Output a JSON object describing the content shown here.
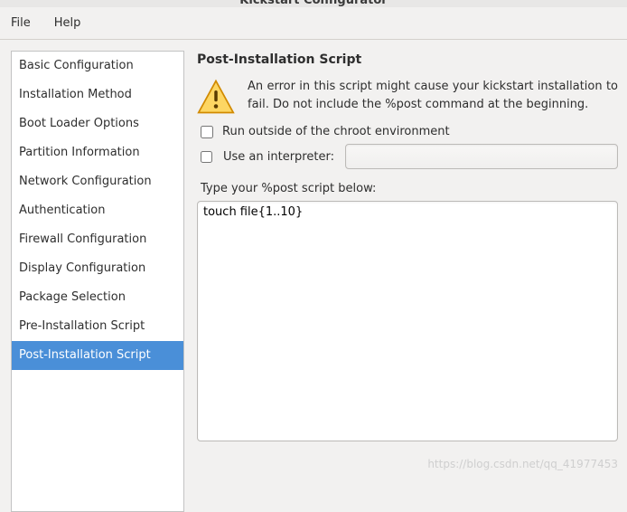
{
  "window": {
    "title": "Kickstart Configurator"
  },
  "menubar": {
    "file": "File",
    "help": "Help"
  },
  "sidebar": {
    "items": [
      {
        "label": "Basic Configuration",
        "selected": false
      },
      {
        "label": "Installation Method",
        "selected": false
      },
      {
        "label": "Boot Loader Options",
        "selected": false
      },
      {
        "label": "Partition Information",
        "selected": false
      },
      {
        "label": "Network Configuration",
        "selected": false
      },
      {
        "label": "Authentication",
        "selected": false
      },
      {
        "label": "Firewall Configuration",
        "selected": false
      },
      {
        "label": "Display Configuration",
        "selected": false
      },
      {
        "label": "Package Selection",
        "selected": false
      },
      {
        "label": "Pre-Installation Script",
        "selected": false
      },
      {
        "label": "Post-Installation Script",
        "selected": true
      }
    ]
  },
  "main": {
    "heading": "Post-Installation Script",
    "warning": "An error in this script might cause your kickstart installation to fail. Do not include the %post command at the beginning.",
    "chroot_label": "Run outside of the chroot environment",
    "interpreter_label": "Use an interpreter:",
    "interpreter_value": "",
    "type_label": "Type your %post script below:",
    "script_value": "touch file{1..10}"
  },
  "watermark": "https://blog.csdn.net/qq_41977453"
}
